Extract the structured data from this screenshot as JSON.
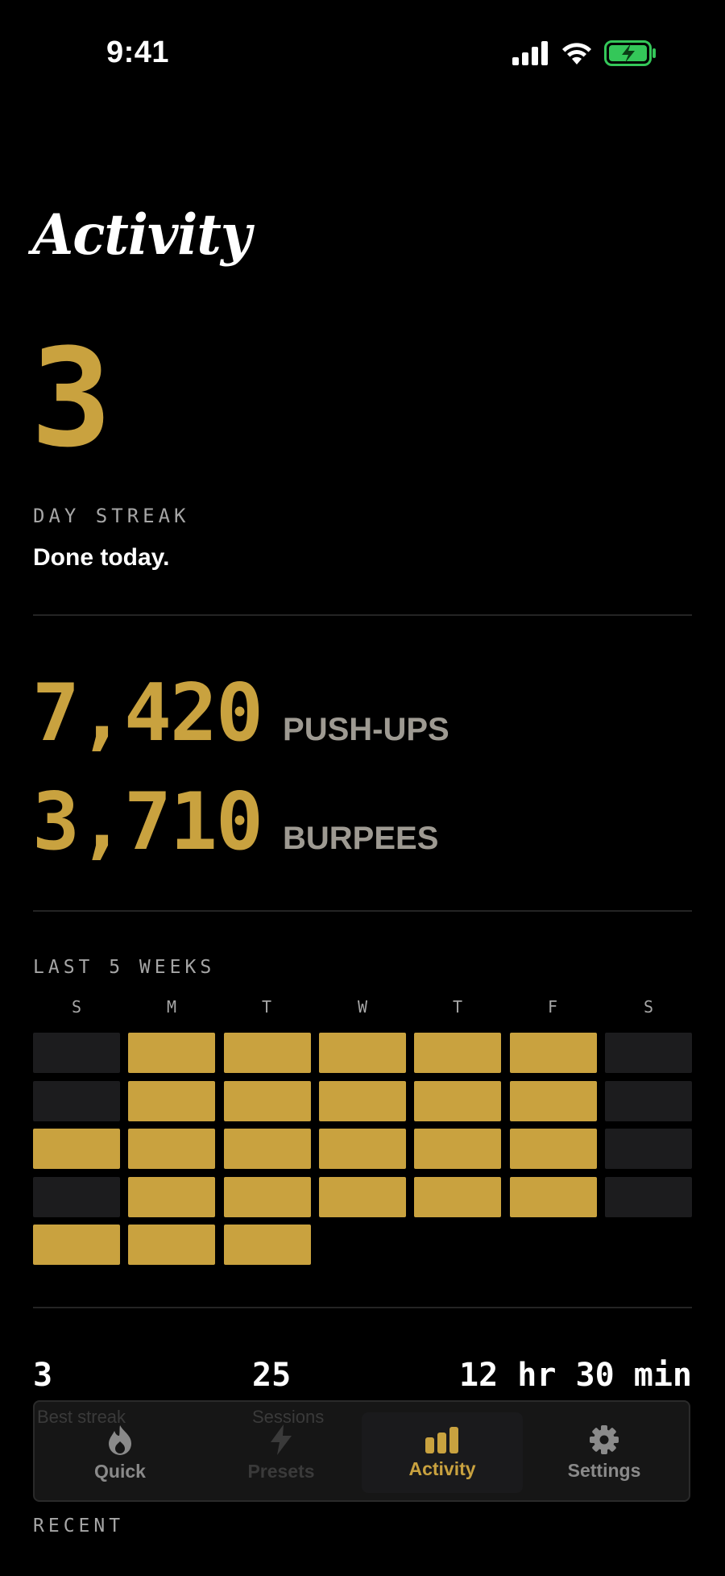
{
  "status_bar": {
    "time": "9:41"
  },
  "title": "Activity",
  "streak": {
    "count": "3",
    "label": "DAY STREAK",
    "subtitle": "Done today."
  },
  "totals": [
    {
      "value": "7,420",
      "label": "PUSH-UPS"
    },
    {
      "value": "3,710",
      "label": "BURPEES"
    }
  ],
  "calendar": {
    "label": "LAST 5 WEEKS",
    "days": [
      "S",
      "M",
      "T",
      "W",
      "T",
      "F",
      "S"
    ],
    "weeks": [
      [
        0,
        1,
        1,
        1,
        1,
        1,
        0
      ],
      [
        0,
        1,
        1,
        1,
        1,
        1,
        0
      ],
      [
        1,
        1,
        1,
        1,
        1,
        1,
        0
      ],
      [
        0,
        1,
        1,
        1,
        1,
        1,
        0
      ],
      [
        1,
        1,
        1
      ]
    ]
  },
  "stats": {
    "first": "3",
    "second": "25",
    "third": "12 hr 30 min"
  },
  "tabbar": {
    "ghost_left": "Best streak",
    "ghost_mid": "Sessions",
    "tabs": [
      {
        "label": "Quick",
        "icon": "flame-icon",
        "state": "normal"
      },
      {
        "label": "Presets",
        "icon": "bolt-icon",
        "state": "dim"
      },
      {
        "label": "Activity",
        "icon": "bar-chart-icon",
        "state": "active"
      },
      {
        "label": "Settings",
        "icon": "gear-icon",
        "state": "normal"
      }
    ]
  },
  "recent_label": "RECENT",
  "colors": {
    "accent": "#c9a23f",
    "cell_off": "#1c1c1e",
    "muted": "#a6a6a6",
    "battery": "#34c759"
  }
}
